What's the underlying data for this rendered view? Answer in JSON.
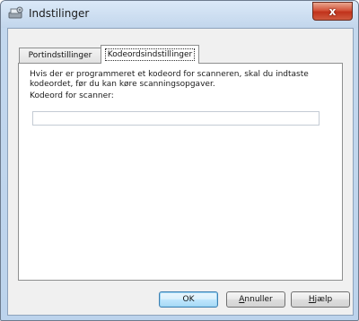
{
  "window": {
    "title": "Indstilinger",
    "close_label": "x"
  },
  "tabs": [
    {
      "label": "Portindstillinger",
      "active": false
    },
    {
      "label": "Kodeordsindstillinger",
      "active": true
    }
  ],
  "panel": {
    "description": "Hvis der er programmeret et kodeord for scanneren, skal du indtaste kodeordet, før du kan køre scanningsopgaver.",
    "password_label": "Kodeord for scanner:",
    "password_value": ""
  },
  "buttons": {
    "ok": "OK",
    "cancel_first": "A",
    "cancel_rest": "nnuller",
    "help_first": "H",
    "help_rest": "jælp"
  },
  "colors": {
    "titlebar": "#c3d8ee",
    "close_button": "#c1321b",
    "ok_border": "#3c7fb1"
  }
}
